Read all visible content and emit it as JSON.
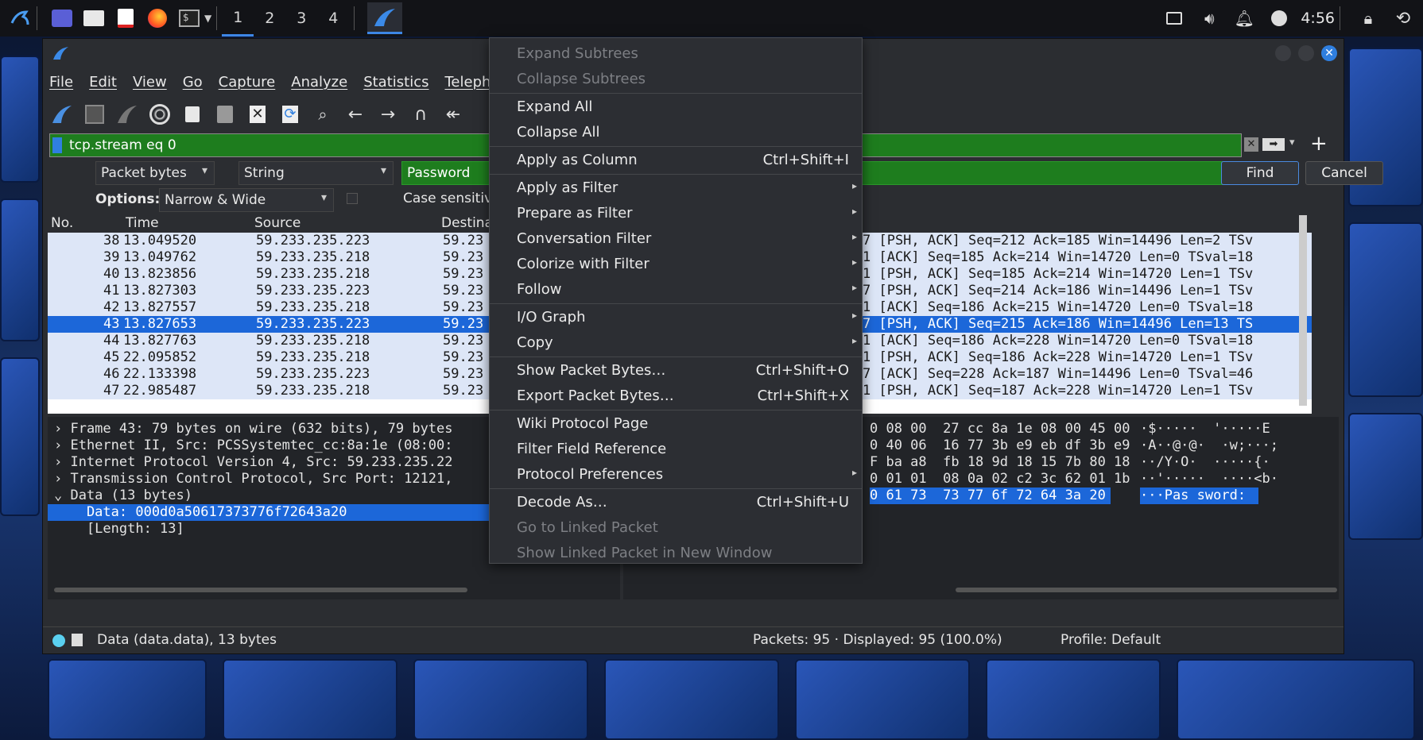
{
  "taskbar": {
    "workspaces": [
      "1",
      "2",
      "3",
      "4"
    ],
    "time": "4:56"
  },
  "menubar": [
    "File",
    "Edit",
    "View",
    "Go",
    "Capture",
    "Analyze",
    "Statistics",
    "Telephony"
  ],
  "filter": {
    "value": "tcp.stream eq 0"
  },
  "find": {
    "search_in": "Packet bytes",
    "type": "String",
    "term": "Password",
    "options_label": "Options:",
    "options_value": "Narrow & Wide",
    "case_sensitive": "Case sensitive",
    "find_btn": "Find",
    "cancel_btn": "Cancel"
  },
  "packet_list": {
    "columns": [
      "No.",
      "Time",
      "Source",
      "Destina"
    ],
    "rows": [
      {
        "no": "38",
        "time": "13.049520",
        "src": "59.233.235.223",
        "dst": "59.23",
        "info": "7 [PSH, ACK] Seq=212 Ack=185 Win=14496 Len=2 TSv"
      },
      {
        "no": "39",
        "time": "13.049762",
        "src": "59.233.235.218",
        "dst": "59.23",
        "info": "1 [ACK] Seq=185 Ack=214 Win=14720 Len=0 TSval=18"
      },
      {
        "no": "40",
        "time": "13.823856",
        "src": "59.233.235.218",
        "dst": "59.23",
        "info": "1 [PSH, ACK] Seq=185 Ack=214 Win=14720 Len=1 TSv"
      },
      {
        "no": "41",
        "time": "13.827303",
        "src": "59.233.235.223",
        "dst": "59.23",
        "info": "7 [PSH, ACK] Seq=214 Ack=186 Win=14496 Len=1 TSv"
      },
      {
        "no": "42",
        "time": "13.827557",
        "src": "59.233.235.218",
        "dst": "59.23",
        "info": "1 [ACK] Seq=186 Ack=215 Win=14720 Len=0 TSval=18"
      },
      {
        "no": "43",
        "time": "13.827653",
        "src": "59.233.235.223",
        "dst": "59.23",
        "info": "7 [PSH, ACK] Seq=215 Ack=186 Win=14496 Len=13 TS"
      },
      {
        "no": "44",
        "time": "13.827763",
        "src": "59.233.235.218",
        "dst": "59.23",
        "info": "1 [ACK] Seq=186 Ack=228 Win=14720 Len=0 TSval=18"
      },
      {
        "no": "45",
        "time": "22.095852",
        "src": "59.233.235.218",
        "dst": "59.23",
        "info": "1 [PSH, ACK] Seq=186 Ack=228 Win=14720 Len=1 TSv"
      },
      {
        "no": "46",
        "time": "22.133398",
        "src": "59.233.235.223",
        "dst": "59.23",
        "info": "7 [ACK] Seq=228 Ack=187 Win=14496 Len=0 TSval=46"
      },
      {
        "no": "47",
        "time": "22.985487",
        "src": "59.233.235.218",
        "dst": "59.23",
        "info": "1 [PSH, ACK] Seq=187 Ack=228 Win=14720 Len=1 TSv"
      }
    ]
  },
  "details": [
    "› Frame 43: 79 bytes on wire (632 bits), 79 bytes",
    "› Ethernet II, Src: PCSSystemtec_cc:8a:1e (08:00:",
    "› Internet Protocol Version 4, Src: 59.233.235.22",
    "› Transmission Control Protocol, Src Port: 12121,",
    "⌄ Data (13 bytes)",
    "    Data: 000d0a50617373776f72643a20",
    "    [Length: 13]"
  ],
  "bytes": [
    {
      "hex": "0 08 00  27 cc 8a 1e 08 00 45 00",
      "ascii": "·$·····  '·····E"
    },
    {
      "hex": "0 40 06  16 77 3b e9 eb df 3b e9",
      "ascii": "·A··@·@·  ·w;···;"
    },
    {
      "hex": "F ba a8  fb 18 9d 18 15 7b 80 18",
      "ascii": "··/Y·O·  ·····{·"
    },
    {
      "hex": "0 01 01  08 0a 02 c2 3c 62 01 1b",
      "ascii": "··'·····  ····<b·"
    },
    {
      "hex": "0 61 73  73 77 6f 72 64 3a 20",
      "ascii": "···Pas sword: "
    }
  ],
  "status": {
    "field": "Data (data.data), 13 bytes",
    "packets": "Packets: 95 · Displayed: 95 (100.0%)",
    "profile": "Profile: Default"
  },
  "context_menu": [
    {
      "label": "Expand Subtrees",
      "disabled": true
    },
    {
      "label": "Collapse Subtrees",
      "disabled": true
    },
    {
      "label": "Expand All"
    },
    {
      "label": "Collapse All"
    },
    {
      "label": "Apply as Column",
      "shortcut": "Ctrl+Shift+I"
    },
    {
      "label": "Apply as Filter",
      "submenu": true
    },
    {
      "label": "Prepare as Filter",
      "submenu": true
    },
    {
      "label": "Conversation Filter",
      "submenu": true
    },
    {
      "label": "Colorize with Filter",
      "submenu": true
    },
    {
      "label": "Follow",
      "submenu": true
    },
    {
      "label": "I/O Graph",
      "submenu": true
    },
    {
      "label": "Copy",
      "submenu": true
    },
    {
      "label": "Show Packet Bytes…",
      "shortcut": "Ctrl+Shift+O"
    },
    {
      "label": "Export Packet Bytes…",
      "shortcut": "Ctrl+Shift+X"
    },
    {
      "label": "Wiki Protocol Page"
    },
    {
      "label": "Filter Field Reference"
    },
    {
      "label": "Protocol Preferences",
      "submenu": true
    },
    {
      "label": "Decode As…",
      "shortcut": "Ctrl+Shift+U"
    },
    {
      "label": "Go to Linked Packet",
      "disabled": true
    },
    {
      "label": "Show Linked Packet in New Window",
      "disabled": true
    }
  ]
}
